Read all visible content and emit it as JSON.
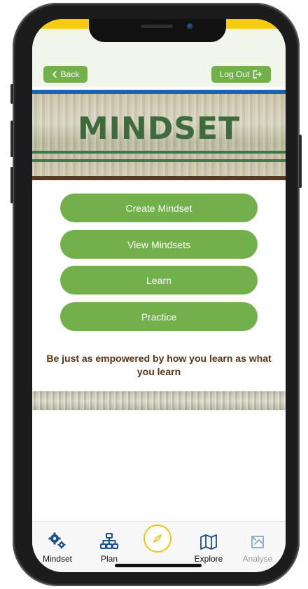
{
  "header": {
    "back_label": "Back",
    "logout_label": "Log Out"
  },
  "banner": {
    "title": "MINDSET"
  },
  "menu": {
    "items": [
      {
        "label": "Create Mindset"
      },
      {
        "label": "View Mindsets"
      },
      {
        "label": "Learn"
      },
      {
        "label": "Practice"
      }
    ]
  },
  "tagline": "Be just as empowered by how you learn as what you learn",
  "tabbar": {
    "items": [
      {
        "label": "Mindset",
        "icon": "gears-icon"
      },
      {
        "label": "Plan",
        "icon": "sitemap-icon"
      },
      {
        "label": "",
        "icon": "compass-icon"
      },
      {
        "label": "Explore",
        "icon": "map-icon"
      },
      {
        "label": "Analyse",
        "icon": "chart-icon"
      }
    ]
  },
  "colors": {
    "accent_green": "#71b04a",
    "brand_yellow": "#f5cc0f",
    "brand_blue": "#1b63b4",
    "tagline_brown": "#5a3313",
    "tab_icon_blue": "#1b4f8c"
  }
}
